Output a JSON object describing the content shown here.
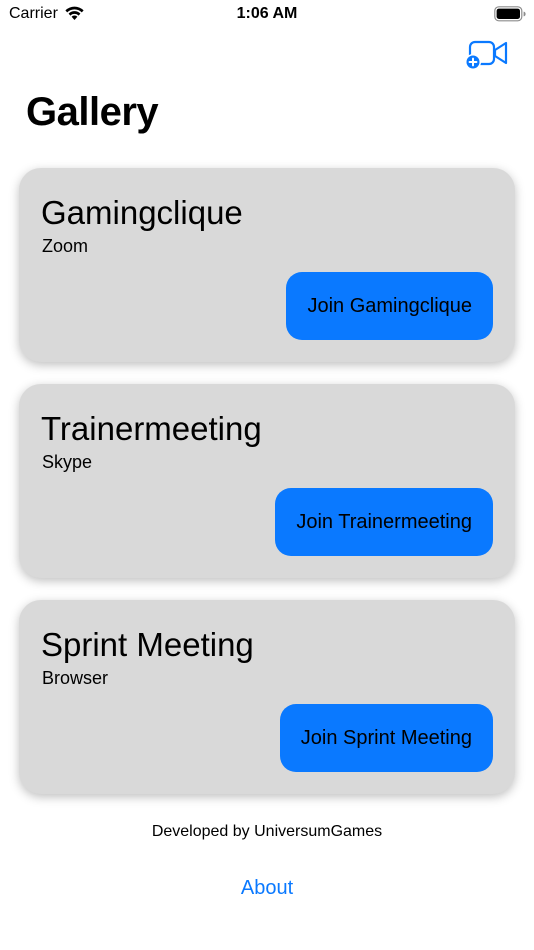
{
  "status_bar": {
    "carrier": "Carrier",
    "time": "1:06 AM",
    "wifi_icon": "wifi-icon",
    "battery_icon": "battery-icon"
  },
  "nav": {
    "action_icon": "video-plus-icon",
    "accent_color": "#0a79ff"
  },
  "page": {
    "title": "Gallery"
  },
  "meetings": [
    {
      "title": "Gamingclique",
      "platform": "Zoom",
      "button_label": "Join Gamingclique"
    },
    {
      "title": "Trainermeeting",
      "platform": "Skype",
      "button_label": "Join Trainermeeting"
    },
    {
      "title": "Sprint Meeting",
      "platform": "Browser",
      "button_label": "Join Sprint Meeting"
    }
  ],
  "footer": {
    "developer_text": "Developed by UniversumGames",
    "about_label": "About"
  },
  "colors": {
    "card_background": "#d9d9d9",
    "button_background": "#0a79ff"
  }
}
